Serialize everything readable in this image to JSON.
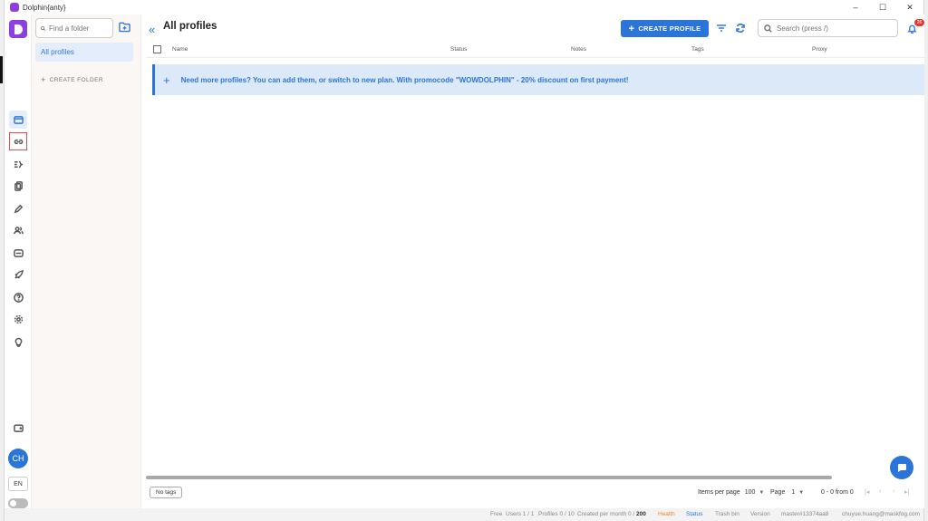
{
  "window": {
    "title": "Dolphin{anty}",
    "controls": [
      "–",
      "☐",
      "✕"
    ]
  },
  "rail": {
    "items": [
      "browser-profiles",
      "proxies",
      "automation",
      "copy-profiles",
      "extensions",
      "users",
      "api",
      "launch",
      "help",
      "settings",
      "tips"
    ],
    "bottom": [
      "wallet"
    ],
    "avatar": "CH",
    "language": "EN"
  },
  "folders": {
    "search_placeholder": "Find a folder",
    "all_profiles": "All profiles",
    "create_folder": "CREATE FOLDER"
  },
  "main": {
    "title": "All profiles",
    "create_profile": "CREATE PROFILE",
    "search_placeholder": "Search (press /)",
    "notification_count": "26",
    "columns": {
      "name": "Name",
      "status": "Status",
      "notes": "Notes",
      "tags": "Tags",
      "proxy": "Proxy"
    },
    "banner": "Need more profiles? You can add them, or switch to new plan. With promocode \"WOWDOLPHIN\" - 20% discount on first payment!"
  },
  "footer": {
    "no_tags": "No tags",
    "items_per_page_label": "Items per page",
    "items_per_page_value": "100",
    "page_label": "Page",
    "page_value": "1",
    "range": "0 - 0 from 0"
  },
  "statusbar": {
    "plan": "Free",
    "users": "Users 1 / 1",
    "profiles": "Profiles 0 / 10",
    "created_label": "Created per month 0 /",
    "created_limit": "200",
    "health": "Health",
    "status": "Status",
    "trash": "Trash bin",
    "version": "Version",
    "build": "master#13374aa8",
    "email": "chuyue.huang@maskfog.com"
  },
  "colors": {
    "accent": "#2c75d8",
    "brand": "#8e3fe0",
    "health": "#e8892b",
    "banner_bg": "#dce9f9"
  }
}
